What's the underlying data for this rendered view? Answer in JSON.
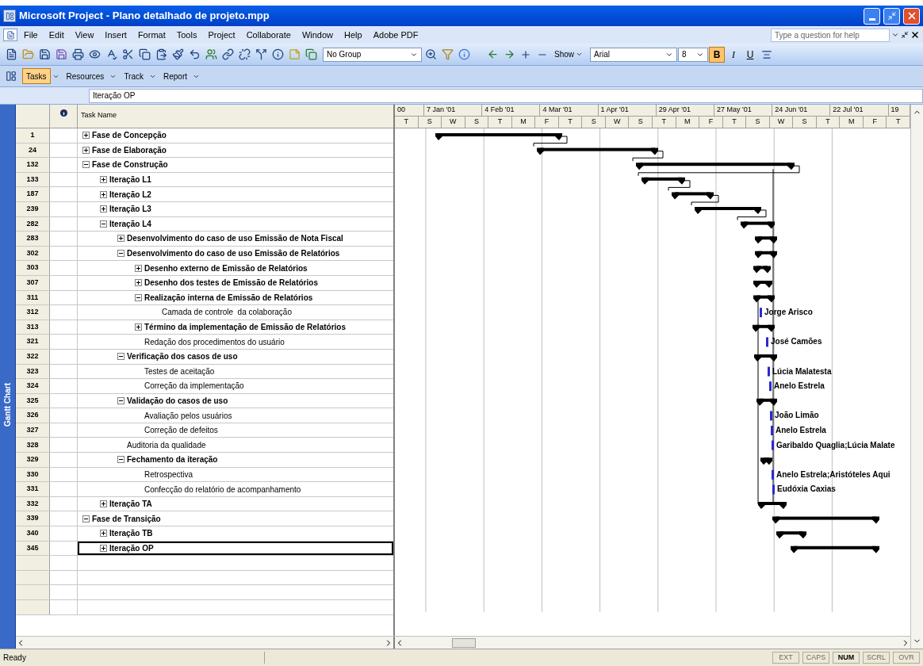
{
  "window": {
    "title": "Microsoft Project - Plano detalhado de projeto.mpp"
  },
  "menu": [
    "File",
    "Edit",
    "View",
    "Insert",
    "Format",
    "Tools",
    "Project",
    "Collaborate",
    "Window",
    "Help",
    "Adobe PDF"
  ],
  "help_box": {
    "placeholder": "Type a question for help"
  },
  "toolbar": {
    "group_select": "No Group",
    "show_button": "Show",
    "font_select": "Arial",
    "size_select": "8",
    "format_buttons": [
      {
        "label": "B",
        "selected": true
      },
      {
        "label": "I",
        "selected": false
      },
      {
        "label": "U",
        "selected": false
      }
    ]
  },
  "guide_tabs": [
    {
      "label": "Tasks",
      "selected": true
    },
    {
      "label": "Resources",
      "selected": false
    },
    {
      "label": "Track",
      "selected": false
    },
    {
      "label": "Report",
      "selected": false
    }
  ],
  "entry_bar": {
    "value": "Iteração OP"
  },
  "view_bar": {
    "label": "Gantt Chart"
  },
  "table": {
    "columns": [
      "Task Name"
    ],
    "tasks": [
      {
        "id": "1",
        "name": "Fase de Concepção",
        "expanded": false,
        "selected": false
      },
      {
        "id": "24",
        "name": "Fase de Elaboração",
        "expanded": false,
        "selected": false
      },
      {
        "id": "132",
        "name": "Fase de Construção",
        "expanded": true,
        "selected": false,
        "children": [
          {
            "id": "133",
            "name": "Iteração L1",
            "expanded": false,
            "selected": false
          },
          {
            "id": "187",
            "name": "Iteração L2",
            "expanded": false,
            "selected": false
          },
          {
            "id": "239",
            "name": "Iteração L3",
            "expanded": false,
            "selected": false
          },
          {
            "id": "282",
            "name": "Iteração L4",
            "expanded": true,
            "selected": false,
            "children": [
              {
                "id": "283",
                "name": "Desenvolvimento do caso de uso Emissão de Nota Fiscal",
                "expanded": false,
                "selected": false
              },
              {
                "id": "302",
                "name": "Desenvolvimento do caso de uso Emissão de Relatórios",
                "expanded": true,
                "selected": false,
                "children": [
                  {
                    "id": "303",
                    "name": "Desenho externo de Emissão de Relatórios",
                    "expanded": false,
                    "selected": false
                  },
                  {
                    "id": "307",
                    "name": "Desenho dos testes de Emissão de Relatórios",
                    "expanded": false,
                    "selected": false
                  },
                  {
                    "id": "311",
                    "name": "Realização interna de Emissão de Relatórios",
                    "expanded": true,
                    "selected": false,
                    "children": [
                      {
                        "id": "312",
                        "name": "Camada de controle  da colaboração",
                        "selected": false,
                        "resource": "Jorge Arisco"
                      }
                    ]
                  },
                  {
                    "id": "313",
                    "name": "Término da implementação de Emissão de Relatórios",
                    "expanded": false,
                    "selected": false
                  },
                  {
                    "id": "321",
                    "name": "Redação dos procedimentos do usuário",
                    "selected": false,
                    "resource": "José Camões"
                  }
                ]
              },
              {
                "id": "322",
                "name": "Verificação dos casos de uso",
                "expanded": true,
                "selected": false,
                "children": [
                  {
                    "id": "323",
                    "name": "Testes de aceitação",
                    "selected": false,
                    "resource": "Lúcia Malatesta"
                  },
                  {
                    "id": "324",
                    "name": "Correção da implementação",
                    "selected": false,
                    "resource": "Anelo Estrela"
                  }
                ]
              },
              {
                "id": "325",
                "name": "Validação do casos de uso",
                "expanded": true,
                "selected": false,
                "children": [
                  {
                    "id": "326",
                    "name": "Avaliação pelos usuários",
                    "selected": false,
                    "resource": "João Limão"
                  },
                  {
                    "id": "327",
                    "name": "Correção de defeitos",
                    "selected": false,
                    "resource": "Anelo Estrela"
                  }
                ]
              },
              {
                "id": "328",
                "name": "Auditoria da qualidade",
                "selected": false,
                "resource": "Garibaldo Quaglia;Lúcia Malate"
              },
              {
                "id": "329",
                "name": "Fechamento da iteração",
                "expanded": true,
                "selected": false,
                "children": [
                  {
                    "id": "330",
                    "name": "Retrospectiva",
                    "selected": false,
                    "resource": "Anelo Estrela;Aristóteles Aqui"
                  },
                  {
                    "id": "331",
                    "name": "Confecção do relatório de acompanhamento",
                    "selected": false,
                    "resource": "Eudóxia Caxias"
                  }
                ]
              }
            ]
          },
          {
            "id": "332",
            "name": "Iteração TA",
            "expanded": false,
            "selected": false
          }
        ]
      },
      {
        "id": "339",
        "name": "Fase de Transição",
        "expanded": true,
        "selected": false,
        "children": [
          {
            "id": "340",
            "name": "Iteração TB",
            "expanded": false,
            "selected": false
          },
          {
            "id": "345",
            "name": "Iteração OP",
            "expanded": false,
            "selected": true
          }
        ]
      }
    ]
  },
  "timescale": {
    "major": [
      "00",
      "7 Jan '01",
      "4 Feb '01",
      "4 Mar '01",
      "1 Apr '01",
      "29 Apr '01",
      "27 May '01",
      "24 Jun '01",
      "22 Jul '01",
      "19"
    ],
    "minor": [
      "T",
      "S",
      "W",
      "S",
      "T",
      "M",
      "F",
      "T",
      "S",
      "W",
      "S",
      "T",
      "M",
      "F",
      "T",
      "S",
      "W",
      "S",
      "T",
      "M",
      "F",
      "T"
    ]
  },
  "status_bar": {
    "text": "Ready",
    "indicators": [
      {
        "label": "EXT",
        "on": false
      },
      {
        "label": "CAPS",
        "on": false
      },
      {
        "label": "NUM",
        "on": true
      },
      {
        "label": "SCRL",
        "on": false
      },
      {
        "label": "OVR",
        "on": false
      }
    ]
  }
}
